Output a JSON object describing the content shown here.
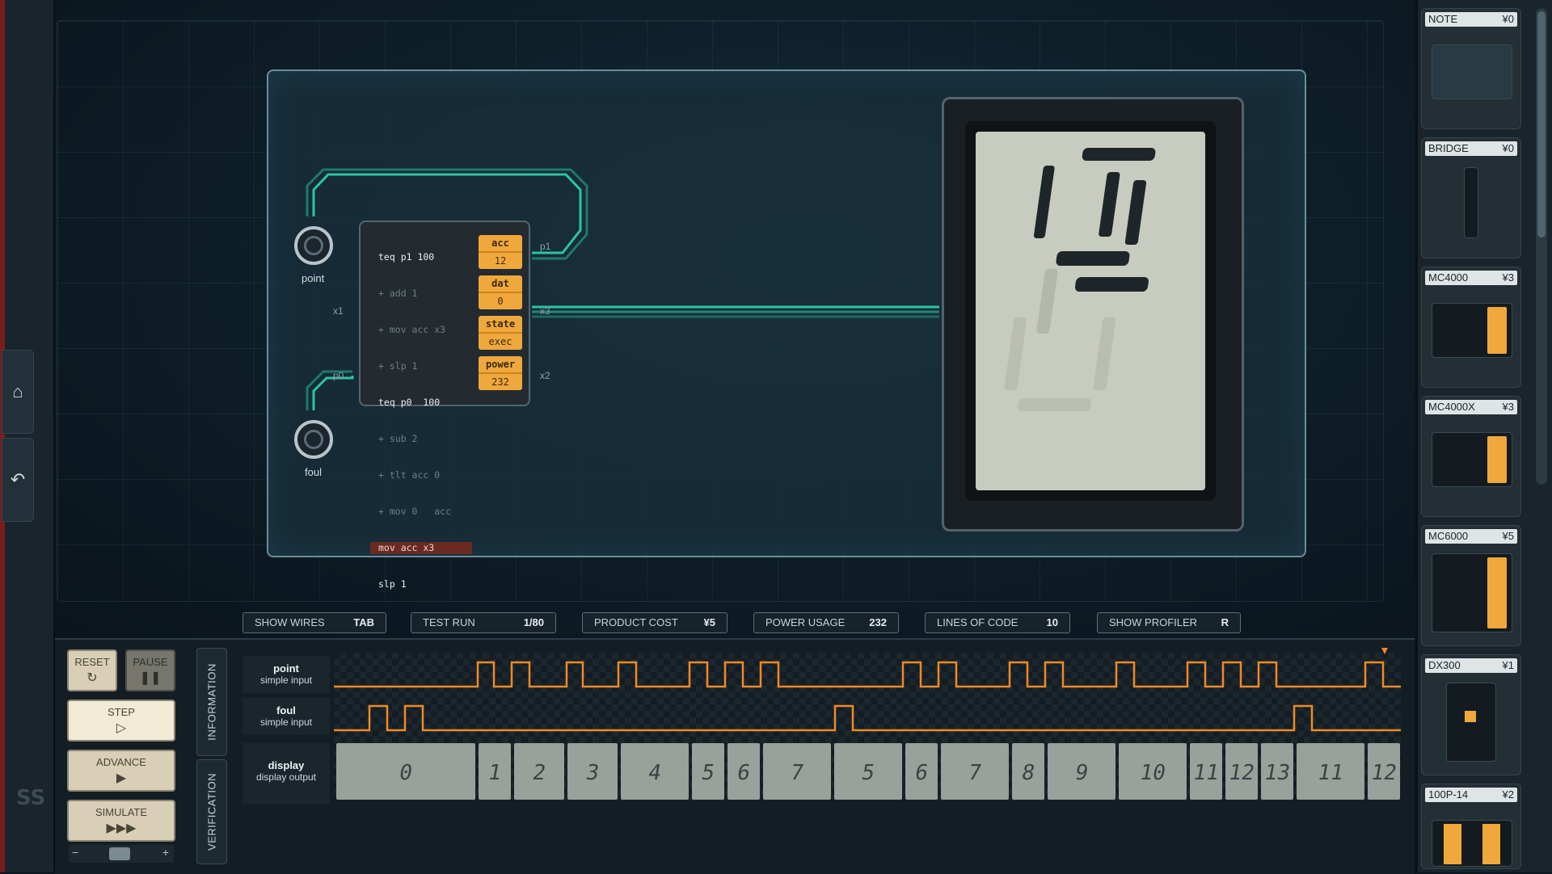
{
  "left_rail": {
    "home_icon": "home-icon",
    "undo_icon": "undo-icon",
    "logo_text": "SS"
  },
  "board": {
    "ports": [
      {
        "name": "point"
      },
      {
        "name": "foul"
      }
    ],
    "pins": {
      "p1": "p1",
      "x1": "x1",
      "x3": "x3",
      "p0": "p0",
      "x2": "x2"
    },
    "mc": {
      "code": [
        {
          "text": "teq p1 100",
          "style": "bright"
        },
        {
          "text": "+ add 1",
          "style": "dim"
        },
        {
          "text": "+ mov acc x3",
          "style": "dim"
        },
        {
          "text": "+ slp 1",
          "style": "dim"
        },
        {
          "text": "teq p0  100",
          "style": "bright"
        },
        {
          "text": "+ sub 2",
          "style": "dim"
        },
        {
          "text": "+ tlt acc 0",
          "style": "dim"
        },
        {
          "text": "+ mov 0   acc",
          "style": "dim"
        },
        {
          "text": "mov acc x3",
          "style": "hl"
        },
        {
          "text": "slp 1",
          "style": "bright"
        }
      ],
      "registers": [
        {
          "name": "acc",
          "value": "12"
        },
        {
          "name": "dat",
          "value": "0"
        },
        {
          "name": "state",
          "value": "exec"
        },
        {
          "name": "power",
          "value": "232"
        }
      ]
    },
    "display_value": "12"
  },
  "stats": {
    "show_wires": {
      "label": "SHOW WIRES",
      "key": "TAB"
    },
    "test_run": {
      "label": "TEST RUN",
      "value": "1/80"
    },
    "product_cost": {
      "label": "PRODUCT COST",
      "value": "¥5"
    },
    "power_usage": {
      "label": "POWER USAGE",
      "value": "232"
    },
    "lines_of_code": {
      "label": "LINES OF CODE",
      "value": "10"
    },
    "show_profiler": {
      "label": "SHOW PROFILER",
      "key": "R"
    }
  },
  "controls": {
    "reset": "RESET",
    "pause": "PAUSE",
    "step": "STEP",
    "advance": "ADVANCE",
    "simulate": "SIMULATE",
    "minus": "−",
    "plus": "+"
  },
  "tabs": {
    "information": "INFORMATION",
    "verification": "VERIFICATION"
  },
  "rows": [
    {
      "name": "point",
      "type": "simple input"
    },
    {
      "name": "foul",
      "type": "simple input"
    },
    {
      "name": "display",
      "type": "display output"
    }
  ],
  "display_sequence": [
    "0",
    "1",
    "2",
    "3",
    "4",
    "5",
    "6",
    "7",
    "5",
    "6",
    "7",
    "8",
    "9",
    "10",
    "11",
    "12",
    "13",
    "11",
    "12"
  ],
  "palette": [
    {
      "name": "NOTE",
      "price": "¥0"
    },
    {
      "name": "BRIDGE",
      "price": "¥0"
    },
    {
      "name": "MC4000",
      "price": "¥3"
    },
    {
      "name": "MC4000X",
      "price": "¥3"
    },
    {
      "name": "MC6000",
      "price": "¥5"
    },
    {
      "name": "DX300",
      "price": "¥1"
    },
    {
      "name": "100P-14",
      "price": "¥2"
    }
  ],
  "colors": {
    "wire": "#2fd6b0",
    "signal": "#f08a24",
    "register": "#f0a83c",
    "highlight": "#6a2a22"
  }
}
